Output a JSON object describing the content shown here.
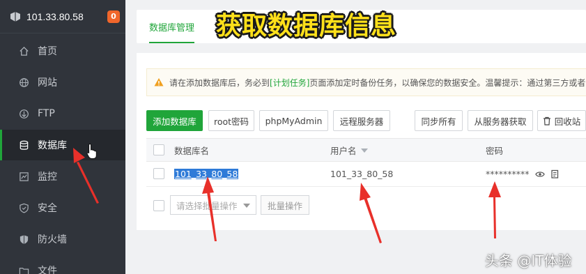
{
  "server": {
    "ip": "101.33.80.58",
    "badge": "0"
  },
  "sidebar": {
    "items": [
      {
        "label": "首页",
        "icon": "home-icon"
      },
      {
        "label": "网站",
        "icon": "globe-icon"
      },
      {
        "label": "FTP",
        "icon": "ftp-icon"
      },
      {
        "label": "数据库",
        "icon": "database-icon",
        "active": true
      },
      {
        "label": "监控",
        "icon": "monitor-icon"
      },
      {
        "label": "安全",
        "icon": "shield-icon"
      },
      {
        "label": "防火墙",
        "icon": "firewall-icon"
      },
      {
        "label": "文件",
        "icon": "folder-icon"
      }
    ]
  },
  "tabs": {
    "active": "数据库管理"
  },
  "overlay_title": "获取数据库信息",
  "notice": {
    "prefix": "请在添加数据库后，务必到",
    "link": "[计划任务]",
    "suffix": "页面添加定时备份任务，以确保您的数据安全。温馨提示：通过第三方或者"
  },
  "toolbar": {
    "add": "添加数据库",
    "root_password": "root密码",
    "phpmyadmin": "phpMyAdmin",
    "remote_server": "远程服务器",
    "sync_all": "同步所有",
    "fetch_from_server": "从服务器获取",
    "recycle_bin": "回收站"
  },
  "table": {
    "headers": {
      "name": "数据库名",
      "user": "用户名",
      "password": "密码"
    },
    "rows": [
      {
        "name": "101_33_80_58",
        "user": "101_33_80_58",
        "password": "**********"
      }
    ]
  },
  "batch": {
    "placeholder": "请选择批量操作",
    "button": "批量操作"
  },
  "watermark": "头条 @IT体验",
  "colors": {
    "accent": "#20a53a",
    "sidebar_bg": "#30343b",
    "badge": "#f0662b",
    "overlay_text": "#ffe01a",
    "annotation_arrow": "#e8302a"
  }
}
